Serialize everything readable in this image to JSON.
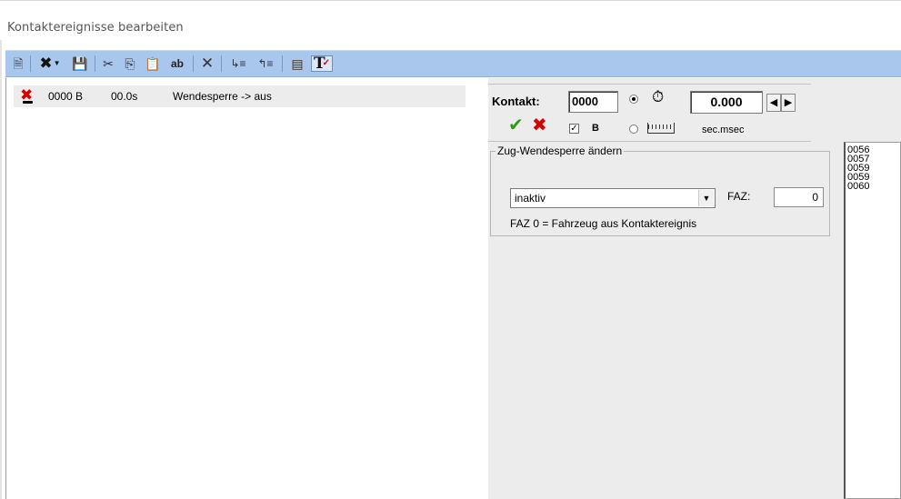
{
  "window": {
    "title": "Kontaktereignisse bearbeiten"
  },
  "toolbar": {
    "items": [
      {
        "name": "new-document-icon",
        "glyph": "🗎"
      },
      {
        "name": "disable-event-icon",
        "glyph": "✖",
        "dropdown": true
      },
      {
        "name": "save-icon",
        "glyph": "💾"
      },
      {
        "name": "cut-icon",
        "glyph": "✂"
      },
      {
        "name": "copy-icon",
        "glyph": "⎘"
      },
      {
        "name": "paste-icon",
        "glyph": "📋"
      },
      {
        "name": "paste-special-icon",
        "glyph": "ab"
      },
      {
        "name": "delete-icon",
        "glyph": "✕"
      },
      {
        "name": "move-down-icon",
        "glyph": "↳≡"
      },
      {
        "name": "move-up-icon",
        "glyph": "↰≡"
      },
      {
        "name": "list-view-icon",
        "glyph": "▤"
      },
      {
        "name": "text-tool-icon",
        "glyph": "T"
      }
    ]
  },
  "event_list": {
    "rows": [
      {
        "icon": "disabled-event-icon",
        "contact": "0000 B",
        "time": "00.0s",
        "description": "Wendesperre -> aus"
      }
    ]
  },
  "contact_panel": {
    "kontakt_label": "Kontakt:",
    "kontakt_value": "0000",
    "time_value": "0.000",
    "time_unit": "sec.msec",
    "b_checkbox_label": "B",
    "b_checked": true,
    "radio_timer_selected": true
  },
  "group": {
    "legend": "Zug-Wendesperre ändern",
    "combo_value": "inaktiv",
    "faz_label": "FAZ:",
    "faz_value": "0",
    "note": "FAZ 0 = Fahrzeug aus Kontaktereignis"
  },
  "side_list": {
    "items": [
      "0056",
      "0057",
      "0059",
      "0059",
      "0060"
    ]
  },
  "colors": {
    "toolbar_bg": "#a9c6ec",
    "accept_green": "#2e9a16",
    "cancel_red": "#d40000"
  }
}
